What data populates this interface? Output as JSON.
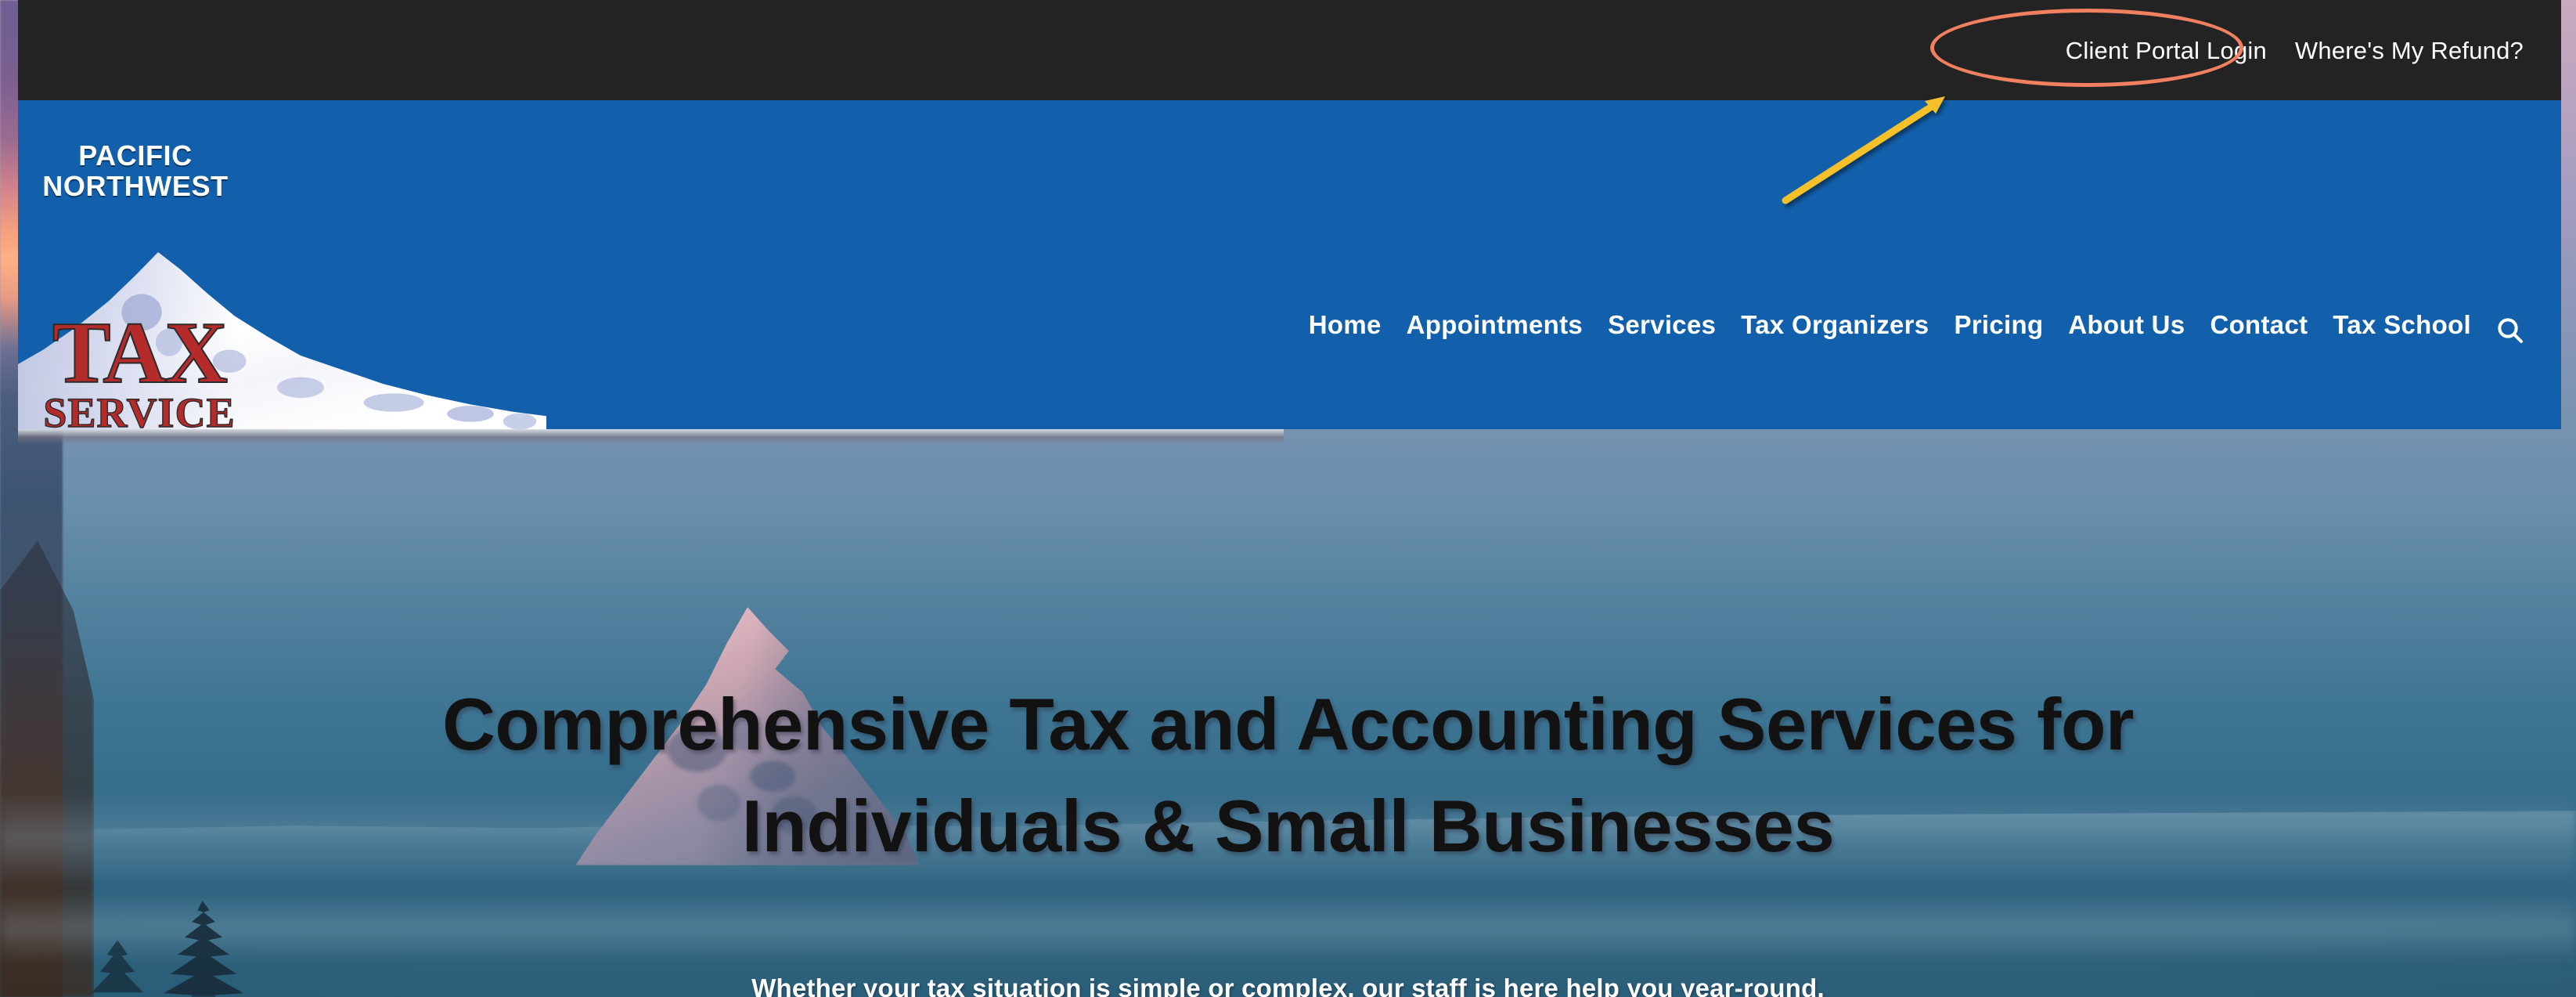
{
  "site": {
    "brand": {
      "line1": "PACIFIC",
      "line2": "NORTHWEST",
      "word_tax": "TAX",
      "word_service": "SERVICE",
      "logo_icon": "mountain-logo-icon"
    },
    "colors": {
      "header_blue": "#1260AC",
      "topbar_dark": "#232323",
      "logo_red": "#B52B2B",
      "annotation_ellipse": "#F0805F",
      "annotation_arrow": "#F5C02A",
      "nav_text": "#FFFFFF",
      "hero_heading": "#121212"
    }
  },
  "topbar": {
    "links": [
      {
        "label": "Client Portal Login",
        "name": "client-portal-login-link"
      },
      {
        "label": "Where's My Refund?",
        "name": "wheres-my-refund-link"
      }
    ]
  },
  "nav": {
    "items": [
      {
        "label": "Home"
      },
      {
        "label": "Appointments"
      },
      {
        "label": "Services"
      },
      {
        "label": "Tax Organizers"
      },
      {
        "label": "Pricing"
      },
      {
        "label": "About Us"
      },
      {
        "label": "Contact"
      },
      {
        "label": "Tax School"
      }
    ],
    "search_icon": "search-icon"
  },
  "hero": {
    "heading_line1": "Comprehensive Tax and Accounting Services for",
    "heading_line2": "Individuals & Small Businesses",
    "subheading": "Whether your tax situation is simple or complex, our staff is here help you year-round."
  },
  "annotations": {
    "ellipse_target": "Client Portal Login",
    "arrow": "pointer-arrow-icon"
  }
}
